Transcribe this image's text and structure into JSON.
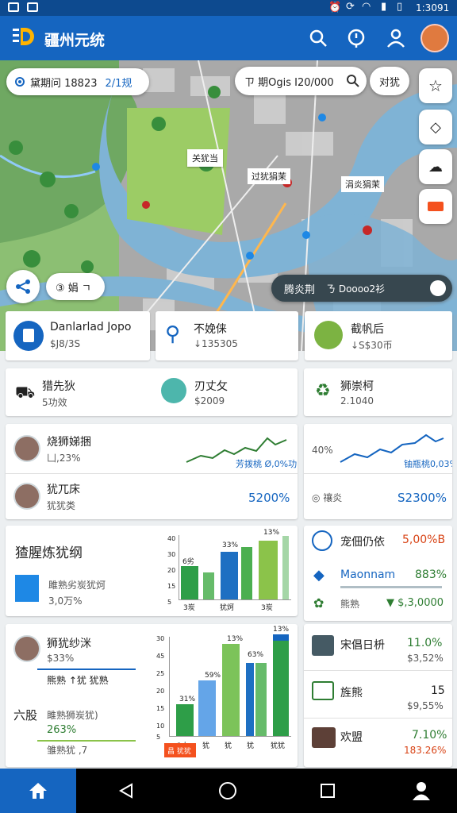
{
  "status": {
    "time": "1:3091"
  },
  "app": {
    "title": "疆州元统"
  },
  "map": {
    "location_pill": {
      "label": "黛期问 18823",
      "value": "2/1规"
    },
    "search_pill": {
      "text": "ㄗ 期Ogis I20/000"
    },
    "filter_pill": {
      "text": "对犹"
    },
    "labels": [
      "关犹当",
      "过犹狷茉",
      "涓炎狷茉"
    ],
    "zoom_pill": {
      "text": "③ 娟 ㄱ"
    },
    "route_pill": {
      "label": "腾炎荆",
      "value": "ㄋ Doooo2衫"
    }
  },
  "row1": [
    {
      "title": "Danlarlad Jopo",
      "value": "$J8/3S"
    },
    {
      "title": "不娩俫",
      "value": "↓135305"
    },
    {
      "title": "截帆后",
      "value": "↓S$30币"
    }
  ],
  "row2": [
    {
      "title": "猎先狄",
      "value": "5功效"
    },
    {
      "title": "刃丈攵",
      "value": "$2009"
    },
    {
      "title": "狮崇柯",
      "value": "2.1040"
    }
  ],
  "row3": {
    "left_top": {
      "title": "烧狮娣捆",
      "sub": "凵,23%",
      "chart_label": "芳拨桃 Ø,0%功"
    },
    "left_bottom": {
      "title": "犹兀床",
      "sub": "犹犹类",
      "value": "5200%"
    },
    "right_top": {
      "label": "40%",
      "chart_label": "铀瓶桃0,03%"
    },
    "right_bottom": {
      "label": "◎ 禳炎",
      "value": "S2300%"
    }
  },
  "row4": {
    "title": "猹腥炼犹纲",
    "sub1": "雎熟劣炭犹炣",
    "sub2": "3,0万%",
    "bar_labels": [
      "6劣",
      "33%",
      "13%"
    ],
    "x_labels": [
      "3炭",
      "犹炣",
      "3炭"
    ],
    "y_ticks": [
      "40",
      "30",
      "20",
      "15",
      "5"
    ]
  },
  "row4_right": [
    {
      "title": "宠佃仍依",
      "value": "5,00%B"
    },
    {
      "title": "Maonnam",
      "value": "883%"
    },
    {
      "title": "熊熟",
      "value": "▼ $,3,0000"
    }
  ],
  "row5": {
    "user_title": "狮犹纱洣",
    "user_sub": "$33%",
    "user_sub2": "熊熟 ↑犹 犹熟",
    "sec_title": "六股",
    "sec_sub": "雎熟狮炭犹)",
    "sec_pct": "263%",
    "sec_bottom": "雏熟犹 ,7",
    "bar_labels": [
      "31%",
      "59%",
      "13%",
      "63%",
      "13%"
    ],
    "x_labels": [
      "3人",
      "犹",
      "犹",
      "犹",
      "犹犹"
    ],
    "y_ticks": [
      "30",
      "45",
      "25",
      "20",
      "15",
      "10",
      "5"
    ],
    "tag": "昌 犹犹"
  },
  "row5_right": [
    {
      "title": "宋倡日枡",
      "value": "11.0%",
      "sub": "$3,52%"
    },
    {
      "title": "旌熊",
      "value": "15",
      "sub": "$9,55%"
    },
    {
      "title": "欢盟",
      "value": "7.10%",
      "sub": "183.26%"
    }
  ],
  "colors": {
    "primary": "#1565c0",
    "green": "#2e7d32",
    "orange": "#d84315",
    "navactive": "#1565c0"
  },
  "nav": {
    "items": [
      "home-icon",
      "back-icon",
      "circle-home-icon",
      "recents-icon",
      "person-icon"
    ]
  }
}
